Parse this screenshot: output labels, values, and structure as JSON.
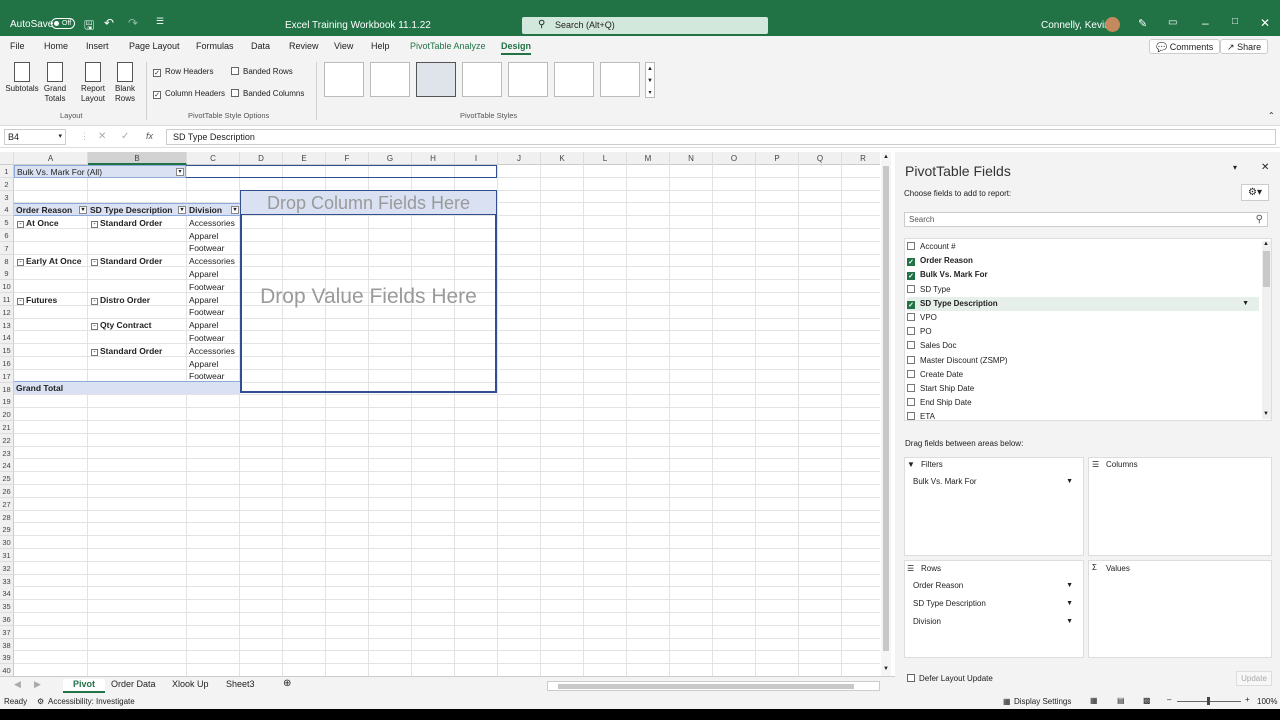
{
  "titlebar": {
    "autosave": "AutoSave",
    "toggle": "Off",
    "file_name": "Excel Training Workbook 11.1.22",
    "search": "Search (Alt+Q)",
    "user": "Connelly, Kevin"
  },
  "menu": [
    "File",
    "Home",
    "Insert",
    "Page Layout",
    "Formulas",
    "Data",
    "Review",
    "View",
    "Help",
    "PivotTable Analyze",
    "Design"
  ],
  "menu_active": "Design",
  "comments_label": "Comments",
  "share_label": "Share",
  "ribbon": {
    "layout_buttons": [
      {
        "label1": "Subtotals",
        "label2": ""
      },
      {
        "label1": "Grand",
        "label2": "Totals"
      },
      {
        "label1": "Report",
        "label2": "Layout"
      },
      {
        "label1": "Blank",
        "label2": "Rows"
      }
    ],
    "layout_group": "Layout",
    "options": {
      "row_headers": "Row Headers",
      "column_headers": "Column Headers",
      "banded_rows": "Banded Rows",
      "banded_columns": "Banded Columns"
    },
    "options_group": "PivotTable Style Options",
    "styles_group": "PivotTable Styles"
  },
  "formula_bar": {
    "name_box": "B4",
    "formula": "SD Type Description"
  },
  "grid": {
    "columns": [
      "A",
      "B",
      "C",
      "D",
      "E",
      "F",
      "G",
      "H",
      "I",
      "J",
      "K",
      "L",
      "M",
      "N",
      "O",
      "P",
      "Q",
      "R"
    ],
    "rows": [
      "1",
      "2",
      "3",
      "4",
      "5",
      "6",
      "7",
      "8",
      "9",
      "10",
      "11",
      "12",
      "13",
      "14",
      "15",
      "16",
      "17",
      "18",
      "19",
      "20",
      "21",
      "22",
      "23",
      "24",
      "25",
      "26",
      "27",
      "28",
      "29",
      "30",
      "31",
      "32",
      "33",
      "34",
      "35",
      "36",
      "37",
      "38",
      "39",
      "40"
    ],
    "filter_cell": "Bulk Vs. Mark For",
    "filter_value": "(All)",
    "headers": [
      "Order Reason",
      "SD Type Description",
      "Division"
    ],
    "drop_column": "Drop Column Fields Here",
    "drop_value": "Drop Value Fields Here",
    "col_a": [
      {
        "row": 5,
        "text": "At Once"
      },
      {
        "row": 8,
        "text": "Early At Once"
      },
      {
        "row": 11,
        "text": "Futures"
      }
    ],
    "col_b": [
      {
        "row": 5,
        "text": "Standard Order"
      },
      {
        "row": 8,
        "text": "Standard Order"
      },
      {
        "row": 11,
        "text": "Distro Order"
      },
      {
        "row": 13,
        "text": "Qty Contract"
      },
      {
        "row": 15,
        "text": "Standard Order"
      }
    ],
    "col_c": [
      {
        "row": 5,
        "text": "Accessories"
      },
      {
        "row": 6,
        "text": "Apparel"
      },
      {
        "row": 7,
        "text": "Footwear"
      },
      {
        "row": 8,
        "text": "Accessories"
      },
      {
        "row": 9,
        "text": "Apparel"
      },
      {
        "row": 10,
        "text": "Footwear"
      },
      {
        "row": 11,
        "text": "Apparel"
      },
      {
        "row": 12,
        "text": "Footwear"
      },
      {
        "row": 13,
        "text": "Apparel"
      },
      {
        "row": 14,
        "text": "Footwear"
      },
      {
        "row": 15,
        "text": "Accessories"
      },
      {
        "row": 16,
        "text": "Apparel"
      },
      {
        "row": 17,
        "text": "Footwear"
      }
    ],
    "grand_total": "Grand Total"
  },
  "sheets": [
    "Pivot",
    "Order Data",
    "Xlook Up",
    "Sheet3"
  ],
  "active_sheet": "Pivot",
  "status": {
    "ready": "Ready",
    "accessibility": "Accessibility: Investigate",
    "display_settings": "Display Settings",
    "zoom": "100%"
  },
  "pivot_pane": {
    "title": "PivotTable Fields",
    "subtitle": "Choose fields to add to report:",
    "search_placeholder": "Search",
    "fields": [
      {
        "name": "Account #",
        "checked": false
      },
      {
        "name": "Order Reason",
        "checked": true
      },
      {
        "name": "Bulk Vs. Mark For",
        "checked": true
      },
      {
        "name": "SD Type",
        "checked": false
      },
      {
        "name": "SD Type Description",
        "checked": true
      },
      {
        "name": "VPO",
        "checked": false
      },
      {
        "name": "PO",
        "checked": false
      },
      {
        "name": "Sales Doc",
        "checked": false
      },
      {
        "name": "Master Discount (ZSMP)",
        "checked": false
      },
      {
        "name": "Create Date",
        "checked": false
      },
      {
        "name": "Start Ship Date",
        "checked": false
      },
      {
        "name": "End Ship Date",
        "checked": false
      },
      {
        "name": "ETA",
        "checked": false
      }
    ],
    "drag_label": "Drag fields between areas below:",
    "filters_label": "Filters",
    "columns_label": "Columns",
    "rows_label": "Rows",
    "values_label": "Values",
    "filters": [
      "Bulk Vs. Mark For"
    ],
    "rows": [
      "Order Reason",
      "SD Type Description",
      "Division"
    ],
    "defer": "Defer Layout Update",
    "update": "Update"
  }
}
